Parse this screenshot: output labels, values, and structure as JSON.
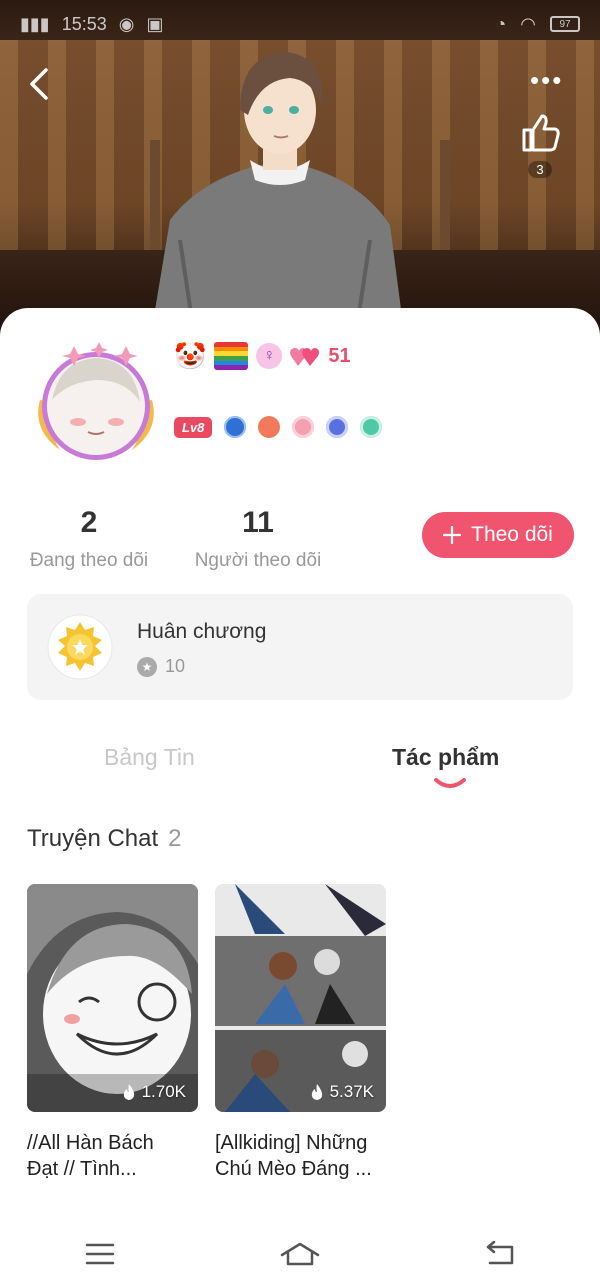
{
  "status_bar": {
    "time": "15:53",
    "battery": "97"
  },
  "header": {
    "like_count": "3"
  },
  "profile": {
    "heart_count": "51",
    "level": "Lv8"
  },
  "stats": {
    "following_count": "2",
    "following_label": "Đang theo dõi",
    "followers_count": "11",
    "followers_label": "Người theo dõi",
    "follow_button_label": "Theo dõi"
  },
  "medal": {
    "title": "Huân chương",
    "points": "10"
  },
  "tabs": [
    {
      "label": "Bảng Tin",
      "active": false
    },
    {
      "label": "Tác phẩm",
      "active": true
    }
  ],
  "section": {
    "title": "Truyện Chat",
    "count": "2"
  },
  "stories": [
    {
      "title_line1": "//All Hàn Bách",
      "title_line2": "Đạt // Tình...",
      "views": "1.70K"
    },
    {
      "title_line1": "[Allkiding] Những",
      "title_line2": "Chú Mèo Đáng ...",
      "views": "5.37K"
    }
  ],
  "colors": {
    "accent": "#f0546e",
    "muted_text": "#999999",
    "card_bg": "#f4f4f4"
  },
  "icons": {
    "back": "chevron-left-icon",
    "more": "more-dots-icon",
    "like": "thumbs-up-icon",
    "follow": "plus-icon",
    "points": "star-icon",
    "views": "flame-icon",
    "menu": "menu-icon",
    "home": "home-icon",
    "return": "return-icon"
  }
}
